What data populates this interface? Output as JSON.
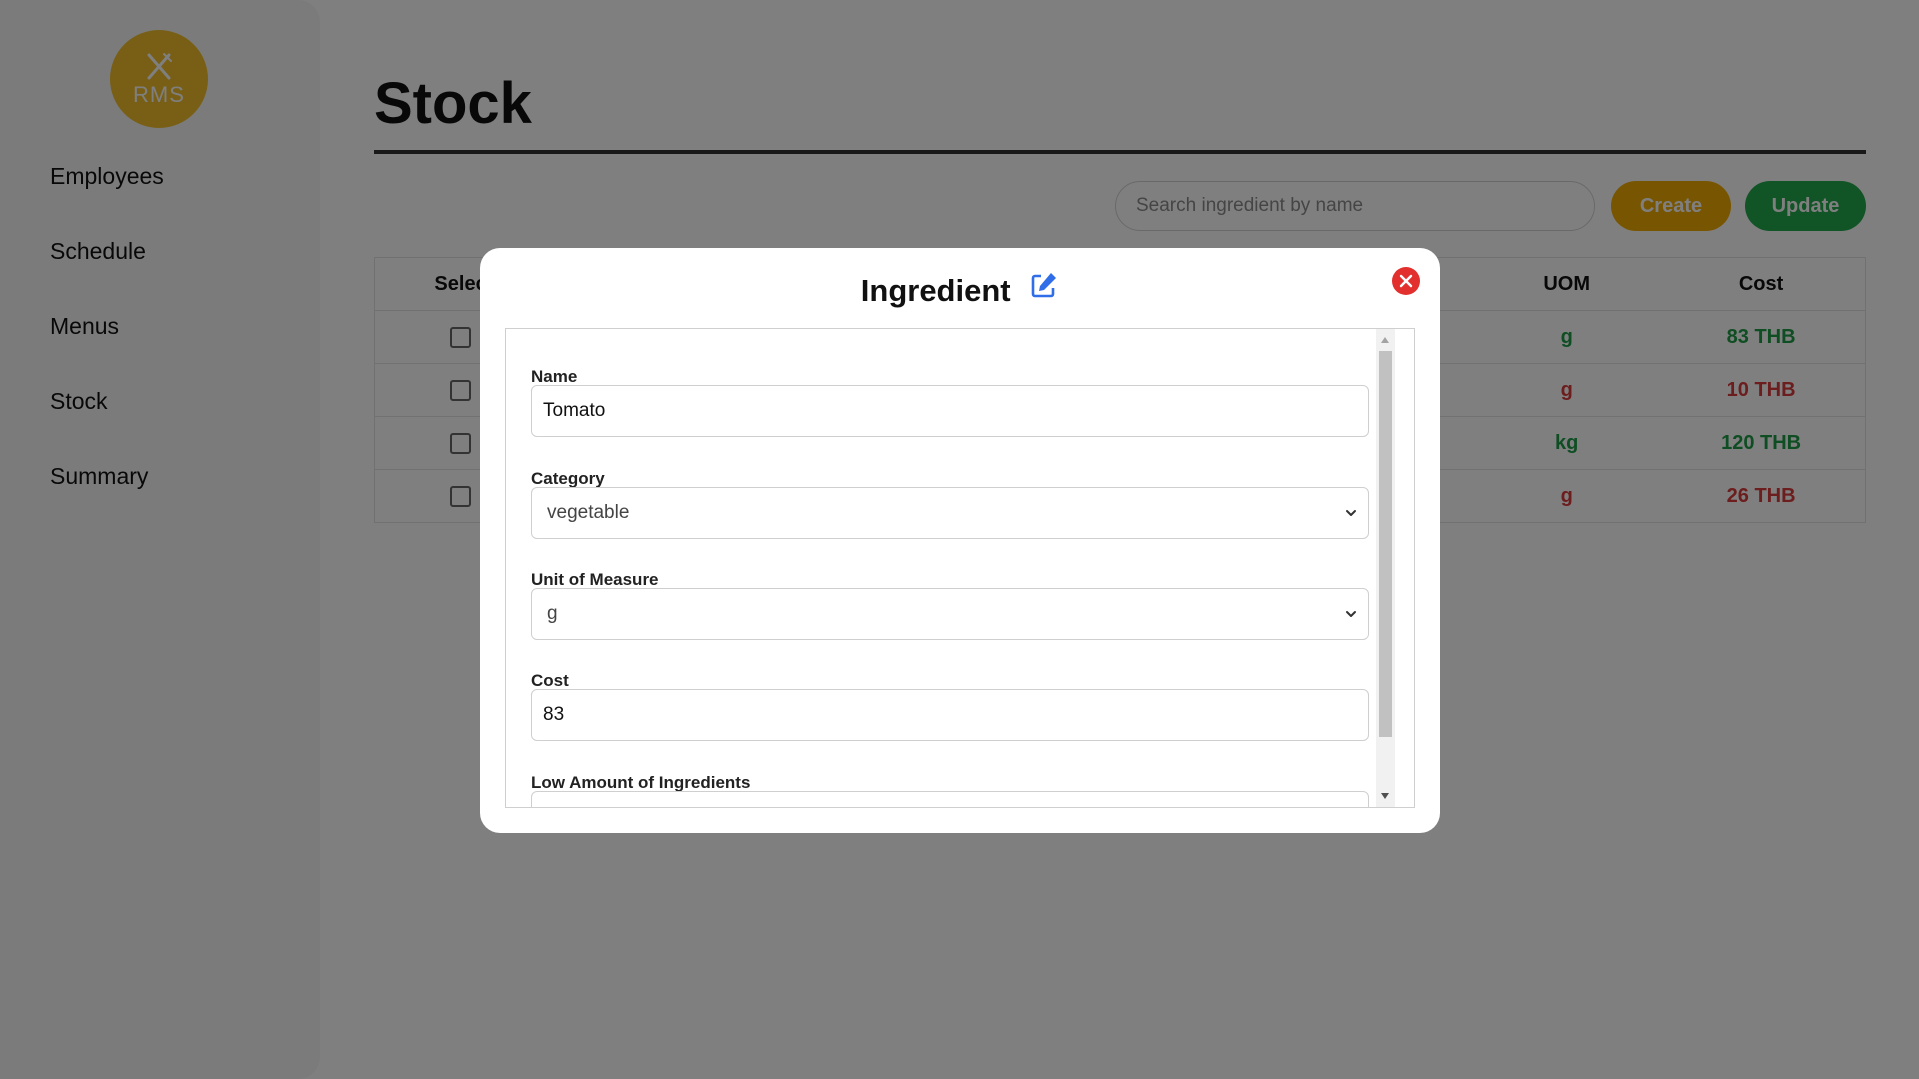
{
  "logo": {
    "text": "RMS",
    "color": "#f0be2a"
  },
  "sidebar": {
    "items": [
      {
        "label": "Employees"
      },
      {
        "label": "Schedule"
      },
      {
        "label": "Menus"
      },
      {
        "label": "Stock"
      },
      {
        "label": "Summary"
      }
    ]
  },
  "page": {
    "title": "Stock"
  },
  "toolbar": {
    "search_placeholder": "Search ingredient by name",
    "create_label": "Create",
    "update_label": "Update"
  },
  "table": {
    "headers": {
      "select": "Selec",
      "uom": "UOM",
      "cost": "Cost"
    },
    "rows": [
      {
        "uom": "g",
        "cost": "83 THB",
        "status": "ok"
      },
      {
        "uom": "g",
        "cost": "10 THB",
        "status": "low"
      },
      {
        "uom": "kg",
        "cost": "120 THB",
        "status": "ok"
      },
      {
        "uom": "g",
        "cost": "26 THB",
        "status": "low"
      }
    ]
  },
  "colors": {
    "ok": "#1f9b46",
    "low": "#d93a3a",
    "create": "#f0ab00",
    "update": "#23a84b",
    "close": "#e2302e",
    "edit_icon": "#2f6ee8"
  },
  "modal": {
    "title": "Ingredient",
    "fields": {
      "name_label": "Name",
      "name_value": "Tomato",
      "category_label": "Category",
      "category_value": "vegetable",
      "uom_label": "Unit of Measure",
      "uom_value": "g",
      "cost_label": "Cost",
      "cost_value": "83",
      "low_label": "Low Amount of Ingredients"
    }
  }
}
